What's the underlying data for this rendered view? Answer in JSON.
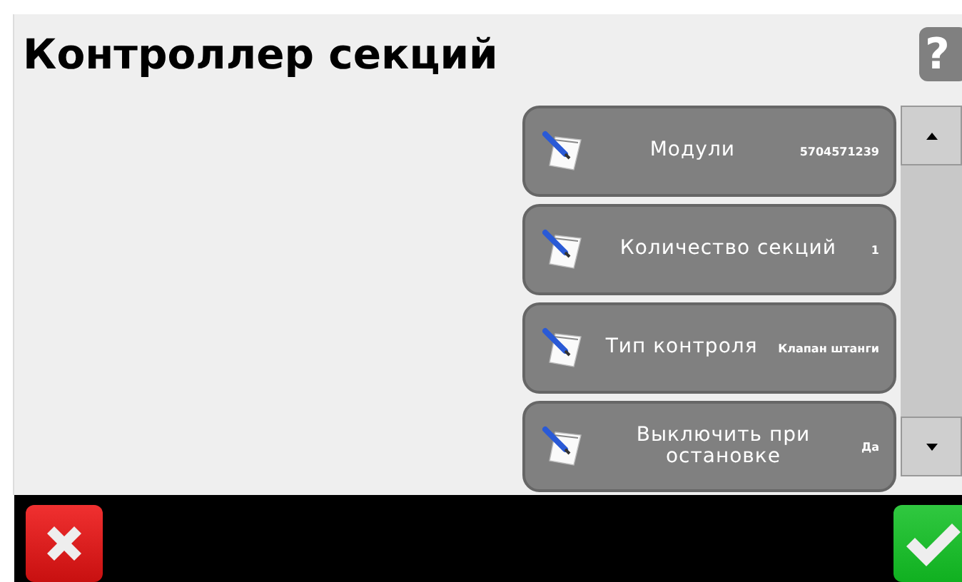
{
  "title": "Контроллер секций",
  "help_button": {
    "label": "?"
  },
  "settings": [
    {
      "label": "Модули",
      "value": "5704571239"
    },
    {
      "label": "Количество секций",
      "value": "1"
    },
    {
      "label": "Тип контроля",
      "value": "Клапан штанги"
    },
    {
      "label": "Выключить при остановке",
      "value": "Да"
    }
  ],
  "footer": {
    "cancel": true,
    "confirm": true
  }
}
